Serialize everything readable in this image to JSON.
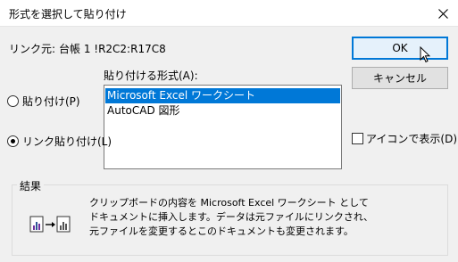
{
  "window": {
    "title": "形式を選択して貼り付け",
    "close_icon": "close-icon"
  },
  "source": {
    "label": "リンク元:",
    "value": "台帳 1 !R2C2:R17C8"
  },
  "paste_as": {
    "label": "貼り付ける形式(A):",
    "items": [
      "Microsoft Excel ワークシート",
      "AutoCAD 図形"
    ],
    "selected_index": 0
  },
  "options": {
    "paste_label": "貼り付け(P)",
    "paste_link_label": "リンク貼り付け(L)",
    "selected": "paste_link"
  },
  "buttons": {
    "ok": "OK",
    "cancel": "キャンセル"
  },
  "display_as_icon": {
    "label": "アイコンで表示(D)",
    "checked": false
  },
  "result": {
    "title": "結果",
    "lines": [
      "クリップボードの内容を Microsoft Excel ワークシート として",
      "ドキュメントに挿入します。データは元ファイルにリンクされ、",
      "元ファイルを変更するとこのドキュメントも変更されます。"
    ],
    "icon": "paste-link-result-icon"
  },
  "colors": {
    "selection": "#0078d7",
    "dialog_bg": "#f0f0f0"
  }
}
